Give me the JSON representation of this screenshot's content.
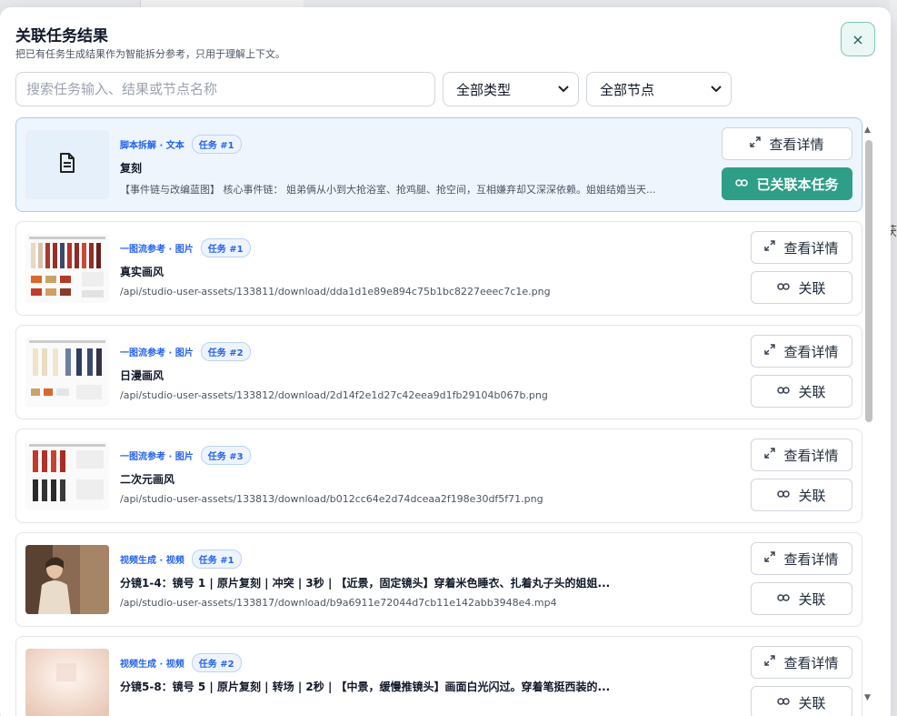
{
  "backdrop": {
    "right_char": "获"
  },
  "dialog": {
    "title": "关联任务结果",
    "subtitle": "把已有任务生成结果作为智能拆分参考，只用于理解上下文。",
    "close_symbol": "×"
  },
  "filters": {
    "search_placeholder": "搜索任务输入、结果或节点名称",
    "type_selected": "全部类型",
    "node_selected": "全部节点"
  },
  "buttons": {
    "detail_label": "查看详情",
    "link_label": "关联",
    "linked_label": "已关联本任务"
  },
  "results": [
    {
      "category": "脚本拆解 · 文本",
      "task": "任务 #1",
      "title": "复刻",
      "subtitle": "【事件链与改编蓝图】 核心事件链： 姐弟俩从小到大抢浴室、抢鸡腿、抢空间，互相嫌弃却又深深依赖。姐姐结婚当天...",
      "thumb": "document-icon",
      "linked": true
    },
    {
      "category": "一图流参考 · 图片",
      "task": "任务 #1",
      "title": "真实画风",
      "subtitle": "/api/studio-user-assets/133811/download/dda1d1e89e894c75b1bc8227eeec7c1e.png",
      "thumb": "character-sheet-realistic",
      "linked": false
    },
    {
      "category": "一图流参考 · 图片",
      "task": "任务 #2",
      "title": "日漫画风",
      "subtitle": "/api/studio-user-assets/133812/download/2d14f2e1d27c42eea9d1fb29104b067b.png",
      "thumb": "character-sheet-anime",
      "linked": false
    },
    {
      "category": "一图流参考 · 图片",
      "task": "任务 #3",
      "title": "二次元画风",
      "subtitle": "/api/studio-user-assets/133813/download/b012cc64e2d74dceaa2f198e30df5f71.png",
      "thumb": "character-sheet-2d",
      "linked": false
    },
    {
      "category": "视频生成 · 视频",
      "task": "任务 #1",
      "title": "分镜1-4：镜号 1 | 原片复刻 | 冲突 | 3秒 | 【近景，固定镜头】穿着米色睡衣、扎着丸子头的姐姐...",
      "subtitle": "/api/studio-user-assets/133817/download/b9a6911e72044d7cb11e142abb3948e4.mp4",
      "thumb": "video-frame-woman",
      "linked": false
    },
    {
      "category": "视频生成 · 视频",
      "task": "任务 #2",
      "title": "分镜5-8：镜号 5 | 原片复刻 | 转场 | 2秒 | 【中景，缓慢推镜头】画面白光闪过。穿着笔挺西装的...",
      "subtitle": "",
      "thumb": "video-frame-light",
      "linked": false
    }
  ]
}
